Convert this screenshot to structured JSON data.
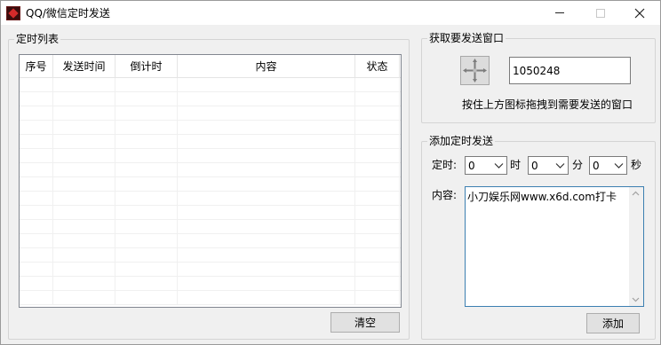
{
  "window": {
    "title": "QQ/微信定时发送"
  },
  "schedule_list": {
    "group_title": "定时列表",
    "columns": [
      "序号",
      "发送时间",
      "倒计时",
      "内容",
      "状态"
    ],
    "rows": [],
    "clear_label": "清空"
  },
  "target_window": {
    "group_title": "获取要发送窗口",
    "handle_value": "1050248",
    "hint": "按住上方图标拖拽到需要发送的窗口"
  },
  "add_schedule": {
    "group_title": "添加定时发送",
    "time_label": "定时:",
    "hour_value": "0",
    "hour_unit": "时",
    "minute_value": "0",
    "minute_unit": "分",
    "second_value": "0",
    "second_unit": "秒",
    "content_label": "内容:",
    "content_value": "小刀娱乐网www.x6d.com打卡",
    "add_label": "添加"
  }
}
